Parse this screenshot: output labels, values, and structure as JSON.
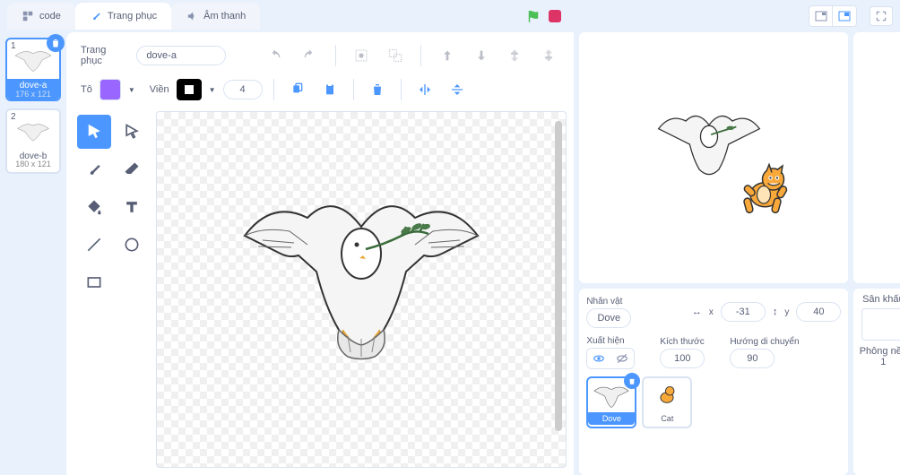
{
  "tabs": {
    "code": "code",
    "costumes": "Trang phục",
    "sounds": "Âm thanh"
  },
  "costumeList": [
    {
      "num": "1",
      "name": "dove-a",
      "dim": "176 x 121"
    },
    {
      "num": "2",
      "name": "dove-b",
      "dim": "180 x 121"
    }
  ],
  "editor": {
    "costumeLabel": "Trang phục",
    "costumeName": "dove-a",
    "fillLabel": "Tô",
    "outlineLabel": "Viền",
    "outlineWidth": "4",
    "fillColor": "#9966ff"
  },
  "spritePanel": {
    "spriteLabel": "Nhân vật",
    "spriteName": "Dove",
    "xLabel": "x",
    "xVal": "-31",
    "yLabel": "y",
    "yVal": "40",
    "showLabel": "Xuất hiện",
    "sizeLabel": "Kích thước",
    "sizeVal": "100",
    "dirLabel": "Hướng di chuyển",
    "dirVal": "90"
  },
  "sprites": [
    {
      "name": "Dove"
    },
    {
      "name": "Cat"
    }
  ],
  "stageCol": {
    "stageLabel": "Sân khấu",
    "backdropLabel": "Phông nền",
    "backdropCount": "1"
  }
}
